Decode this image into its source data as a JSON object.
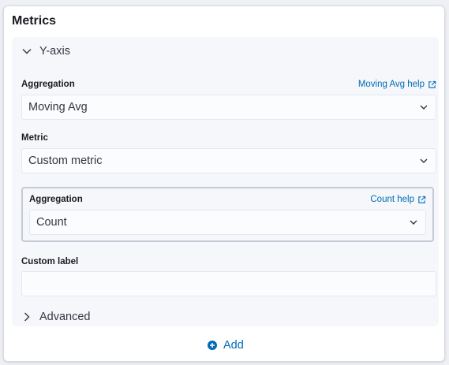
{
  "panel": {
    "title": "Metrics"
  },
  "y_axis": {
    "title": "Y-axis",
    "aggregation": {
      "label": "Aggregation",
      "help_link": "Moving Avg help",
      "value": "Moving Avg"
    },
    "metric": {
      "label": "Metric",
      "value": "Custom metric"
    },
    "custom_metric": {
      "aggregation_label": "Aggregation",
      "help_link": "Count help",
      "value": "Count"
    },
    "custom_label": {
      "label": "Custom label",
      "value": "",
      "placeholder": ""
    },
    "advanced": "Advanced"
  },
  "add_button": {
    "label": "Add"
  },
  "colors": {
    "link": "#006bb8",
    "panel_bg": "#ffffff",
    "group_bg": "#f5f7fa",
    "text": "#343741"
  },
  "icons": {
    "y_axis_toggle": "chevron-down-icon",
    "advanced_toggle": "chevron-right-icon",
    "help_link": "external-link-icon",
    "select": "chevron-down-icon",
    "add": "plus-circle-icon"
  }
}
